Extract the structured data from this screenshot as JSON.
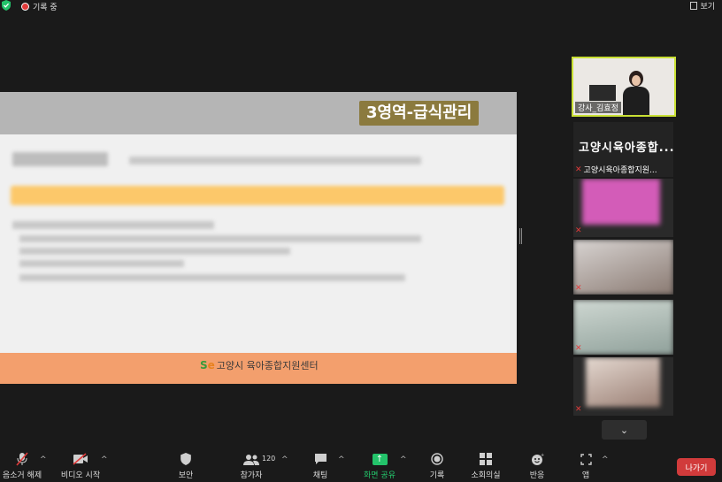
{
  "topbar": {
    "recording_label": "기록 중",
    "view_label": "보기"
  },
  "slide": {
    "title": "3영역-급식관리",
    "logo_text": "고양시 육아종합지원센터",
    "logo_mark": "Se"
  },
  "participants": {
    "speaker_name": "강사_김효정",
    "tiles": [
      {
        "title": "고양시육아종합...",
        "name": "고양시육아종합지원..."
      },
      {
        "title": "",
        "name": ""
      },
      {
        "title": "",
        "name": ""
      },
      {
        "title": "",
        "name": ""
      },
      {
        "title": "",
        "name": ""
      }
    ]
  },
  "toolbar": {
    "mute_label": "음소거 해제",
    "video_label": "비디오 시작",
    "security_label": "보안",
    "participants_label": "참가자",
    "participants_count": "120",
    "chat_label": "채팅",
    "share_label": "화면 공유",
    "record_label": "기록",
    "breakout_label": "소회의실",
    "reactions_label": "반응",
    "apps_label": "앱",
    "leave_label": "나가기"
  }
}
